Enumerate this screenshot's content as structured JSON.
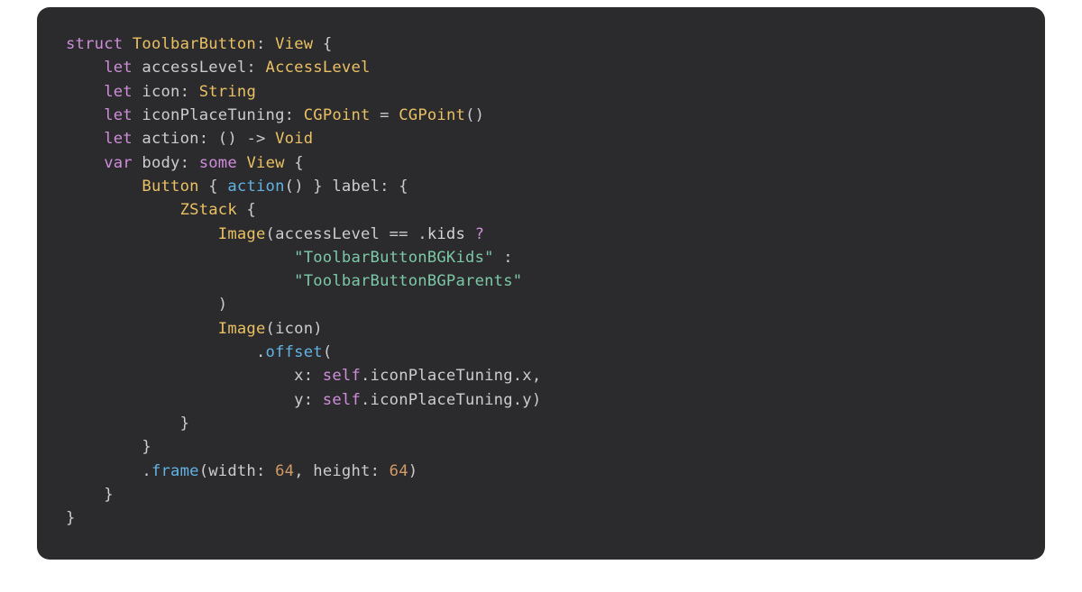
{
  "code": {
    "tokens": [
      [
        [
          "keyword",
          "struct"
        ],
        [
          "punct",
          " "
        ],
        [
          "type",
          "ToolbarButton"
        ],
        [
          "punct",
          ": "
        ],
        [
          "type",
          "View"
        ],
        [
          "punct",
          " {"
        ]
      ],
      [
        [
          "punct",
          "    "
        ],
        [
          "keyword",
          "let"
        ],
        [
          "punct",
          " accessLevel: "
        ],
        [
          "type",
          "AccessLevel"
        ]
      ],
      [
        [
          "punct",
          "    "
        ],
        [
          "keyword",
          "let"
        ],
        [
          "punct",
          " icon: "
        ],
        [
          "type",
          "String"
        ]
      ],
      [
        [
          "punct",
          "    "
        ],
        [
          "keyword",
          "let"
        ],
        [
          "punct",
          " iconPlaceTuning: "
        ],
        [
          "type",
          "CGPoint"
        ],
        [
          "punct",
          " = "
        ],
        [
          "type",
          "CGPoint"
        ],
        [
          "punct",
          "()"
        ]
      ],
      [
        [
          "punct",
          "    "
        ],
        [
          "keyword",
          "let"
        ],
        [
          "punct",
          " action: () "
        ],
        [
          "arrow",
          "->"
        ],
        [
          "punct",
          " "
        ],
        [
          "type",
          "Void"
        ]
      ],
      [
        [
          "punct",
          "    "
        ],
        [
          "keyword",
          "var"
        ],
        [
          "punct",
          " body: "
        ],
        [
          "keyword",
          "some"
        ],
        [
          "punct",
          " "
        ],
        [
          "type",
          "View"
        ],
        [
          "punct",
          " {"
        ]
      ],
      [
        [
          "punct",
          "        "
        ],
        [
          "type",
          "Button"
        ],
        [
          "punct",
          " { "
        ],
        [
          "func",
          "action"
        ],
        [
          "punct",
          "() } label: {"
        ]
      ],
      [
        [
          "punct",
          "            "
        ],
        [
          "type",
          "ZStack"
        ],
        [
          "punct",
          " {"
        ]
      ],
      [
        [
          "punct",
          "                "
        ],
        [
          "type",
          "Image"
        ],
        [
          "punct",
          "(accessLevel == ."
        ],
        [
          "ident",
          "kids"
        ],
        [
          "punct",
          " "
        ],
        [
          "qmark",
          "?"
        ]
      ],
      [
        [
          "punct",
          "                        "
        ],
        [
          "string",
          "\"ToolbarButtonBGKids\""
        ],
        [
          "punct",
          " :"
        ]
      ],
      [
        [
          "punct",
          "                        "
        ],
        [
          "string",
          "\"ToolbarButtonBGParents\""
        ]
      ],
      [
        [
          "punct",
          "                )"
        ]
      ],
      [
        [
          "punct",
          "                "
        ],
        [
          "type",
          "Image"
        ],
        [
          "punct",
          "(icon)"
        ]
      ],
      [
        [
          "punct",
          "                    ."
        ],
        [
          "func",
          "offset"
        ],
        [
          "punct",
          "("
        ]
      ],
      [
        [
          "punct",
          "                        x: "
        ],
        [
          "self",
          "self"
        ],
        [
          "punct",
          ".iconPlaceTuning.x,"
        ]
      ],
      [
        [
          "punct",
          "                        y: "
        ],
        [
          "self",
          "self"
        ],
        [
          "punct",
          ".iconPlaceTuning.y)"
        ]
      ],
      [
        [
          "punct",
          "            }"
        ]
      ],
      [
        [
          "punct",
          "        }"
        ]
      ],
      [
        [
          "punct",
          "        ."
        ],
        [
          "func",
          "frame"
        ],
        [
          "punct",
          "(width: "
        ],
        [
          "number",
          "64"
        ],
        [
          "punct",
          ", height: "
        ],
        [
          "number",
          "64"
        ],
        [
          "punct",
          ")"
        ]
      ],
      [
        [
          "punct",
          "    }"
        ]
      ],
      [
        [
          "punct",
          "}"
        ]
      ]
    ]
  }
}
